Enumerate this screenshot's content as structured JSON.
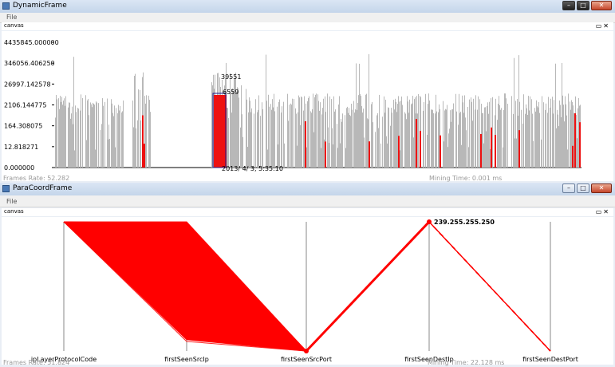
{
  "windows": {
    "top": {
      "title": "DynamicFrame",
      "menu_file": "File",
      "canvas_label": "canvas",
      "frames_rate": "Frames Rate: 52.282",
      "mining_time": "Mining Time: 0.001 ms"
    },
    "bottom": {
      "title": "ParaCoordFrame",
      "menu_file": "File",
      "canvas_label": "canvas",
      "frames_rate": "Frames Rate: 51.824",
      "mining_time": "Mining Time: 22.128 ms"
    }
  },
  "controls": {
    "minimize": "–",
    "maximize": "□",
    "close": "✕"
  },
  "chart_data": [
    {
      "type": "bar",
      "y_scale": "log",
      "y_tick_labels": [
        "0.000000",
        "12.818271",
        "164.308075",
        "2106.144775",
        "26997.142578",
        "346056.406250",
        "4435845.000000"
      ],
      "ylim": [
        0,
        4435845
      ],
      "highlight_values": [
        "39551",
        "6559"
      ],
      "timestamp_label": "2013/ 4/ 3, 5:35:10",
      "colors": {
        "normal": "#b8b8b8",
        "highlight": "#ee1111",
        "selected_outline": "#1c1c8c"
      }
    },
    {
      "type": "parallel-coordinates",
      "axes": [
        "ipLayerProtocolCode",
        "firstSeenSrcIp",
        "firstSeenSrcPort",
        "firstSeenDestIp",
        "firstSeenDestPort"
      ],
      "annotation": "239.255.255.250",
      "line_color": "#ff0000"
    }
  ]
}
